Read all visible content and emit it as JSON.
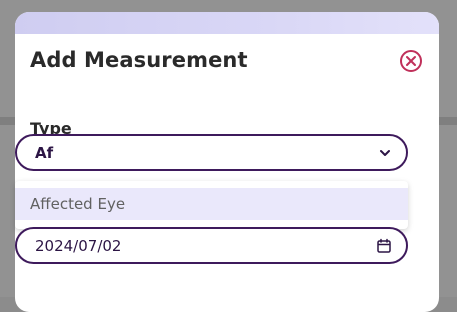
{
  "modal": {
    "title": "Add Measurement",
    "close_icon": "close-circle-icon"
  },
  "type_field": {
    "label": "Type",
    "value": "Af",
    "icon": "chevron-down-icon"
  },
  "dropdown": {
    "options": [
      {
        "label": "Affected Eye",
        "highlighted": true
      }
    ]
  },
  "date_field": {
    "value": "2024/07/02",
    "icon": "calendar-icon"
  },
  "colors": {
    "accent": "#3e1a5c",
    "close": "#c0305a",
    "highlight": "#eae8fb",
    "header_gradient": "#d9d7f6"
  }
}
